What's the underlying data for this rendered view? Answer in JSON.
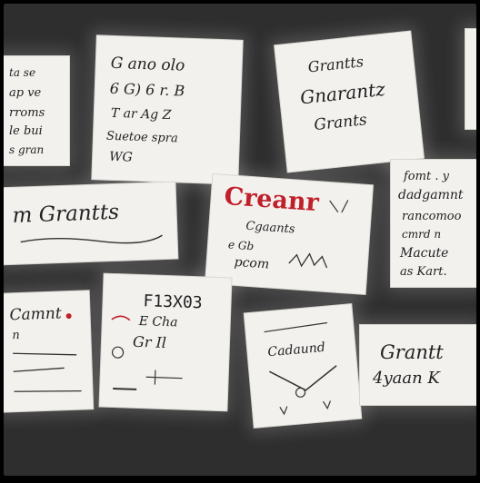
{
  "colors": {
    "background": "#2e2e2e",
    "card": "#f3f1ee",
    "ink": "#222222",
    "accent_red": "#c0202a"
  },
  "cards": {
    "c1": {
      "lines": [
        "ta se",
        "ap ve",
        "rroms",
        "le bui",
        "s gran"
      ]
    },
    "c2": {
      "lines": [
        "G ano olo",
        "6 G) 6 r. B",
        "T ar Ag Z",
        "Suetoe spra",
        "WG"
      ]
    },
    "c3": {
      "lines": [
        "Grantts",
        "Gnarantz",
        "Grants"
      ]
    },
    "c4": {
      "lines": [
        "fomt . y",
        "dadgamnt",
        "rancomoo",
        "cmrd n",
        "Macute",
        "as Kart."
      ]
    },
    "c5": {
      "lines": [
        "m Grantts"
      ]
    },
    "c6": {
      "lines": [
        "Creanr",
        "Cgaants",
        "e Gb",
        "pcom"
      ]
    },
    "c7": {
      "lines": [
        "Camnt",
        "n"
      ]
    },
    "c8": {
      "lines": [
        "F13X03",
        "E Cha",
        "Gr Il"
      ]
    },
    "c9": {
      "lines": [
        "Cadaund"
      ]
    },
    "c10": {
      "lines": [
        "Grantt",
        "4yaan K"
      ]
    }
  }
}
